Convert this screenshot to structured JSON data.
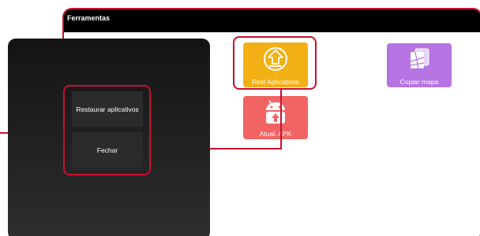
{
  "window": {
    "title": "Ferramentas"
  },
  "tiles": [
    {
      "id": "rest",
      "label": "Rest Aplicativos",
      "icon": "restore-arrow-icon",
      "color": "#f2b015"
    },
    {
      "id": "copy",
      "label": "Copiar mapa",
      "icon": "map-copy-icon",
      "color": "#b674e3"
    },
    {
      "id": "apk",
      "label": "Atual. APK",
      "icon": "android-update-icon",
      "color": "#f26464"
    }
  ],
  "dialog": {
    "restore_label": "Restaurar aplicativos",
    "close_label": "Fechar"
  },
  "colors": {
    "highlight": "#c8102e",
    "titlebar": "#000000",
    "dialog_bg": "#1f1f1f",
    "dialog_button": "#2b2b2b"
  }
}
